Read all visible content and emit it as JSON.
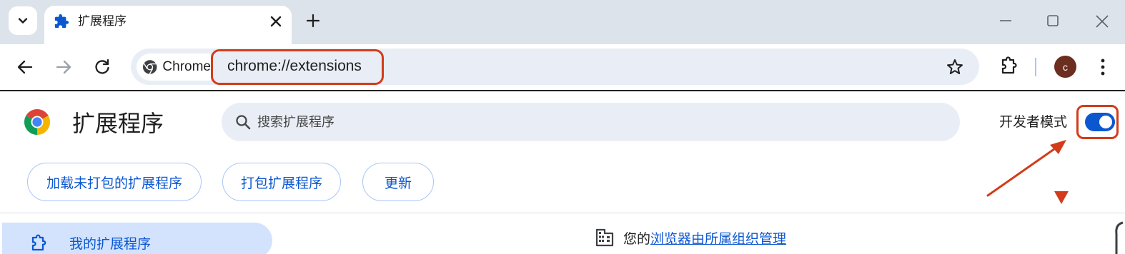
{
  "tab": {
    "title": "扩展程序"
  },
  "omnibox": {
    "chip_label": "Chrome",
    "url": "chrome://extensions"
  },
  "profile": {
    "initial": "c"
  },
  "header": {
    "title": "扩展程序",
    "search_placeholder": "搜索扩展程序",
    "dev_mode_label": "开发者模式",
    "dev_mode_on": true
  },
  "actions": {
    "load_unpacked": "加载未打包的扩展程序",
    "pack": "打包扩展程序",
    "update": "更新"
  },
  "sidebar": {
    "items": [
      {
        "label": "我的扩展程序",
        "selected": true
      }
    ]
  },
  "managed_notice": {
    "prefix": "您的",
    "link": "浏览器由所属组织管理"
  },
  "colors": {
    "accent": "#0b57d0",
    "annotation": "#d23c1a",
    "tabstrip": "#dde3ea",
    "omnibox_bg": "#e9eef6"
  },
  "icons": [
    "tab-search-icon",
    "puzzle-icon",
    "close-icon",
    "plus-icon",
    "minimize-icon",
    "maximize-icon",
    "back-icon",
    "forward-icon",
    "reload-icon",
    "chrome-logo-icon",
    "star-icon",
    "extensions-icon",
    "kebab-menu-icon",
    "search-icon",
    "building-icon"
  ]
}
